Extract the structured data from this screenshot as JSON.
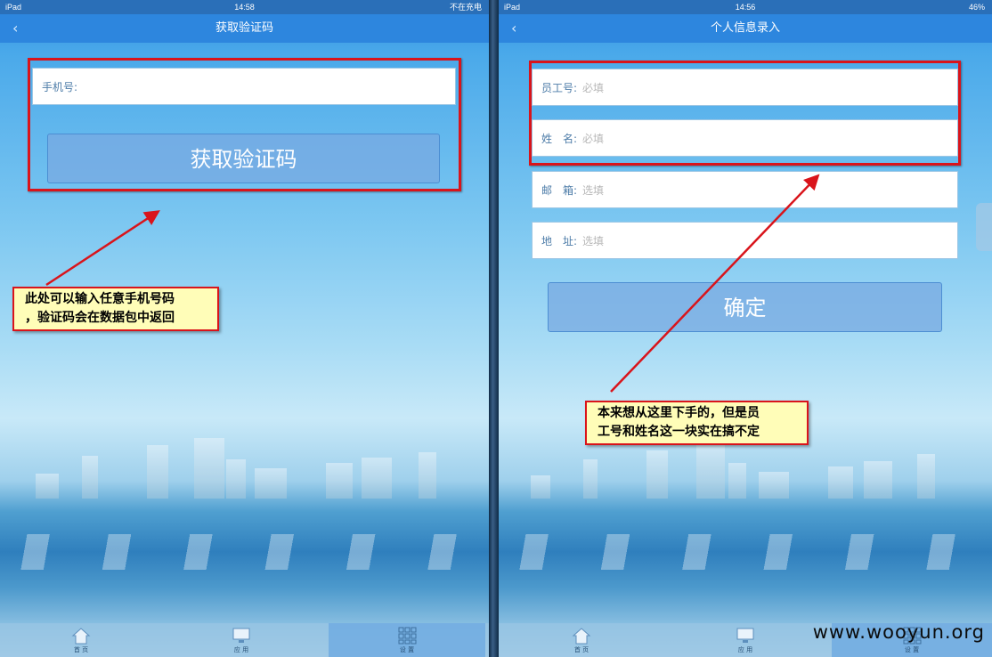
{
  "left": {
    "status": {
      "device": "iPad",
      "time": "14:58",
      "charging": "不在充电"
    },
    "nav": {
      "back": "‹",
      "title": "获取验证码"
    },
    "phone_label": "手机号:",
    "get_code_button": "获取验证码",
    "callout_lines": [
      "此处可以输入任意手机号码",
      "，验证码会在数据包中返回"
    ],
    "tabs": [
      {
        "label": "首 页",
        "icon": "home-icon"
      },
      {
        "label": "应 用",
        "icon": "monitor-icon"
      },
      {
        "label": "设 置",
        "icon": "grid-icon"
      }
    ]
  },
  "right": {
    "status": {
      "device": "iPad",
      "time": "14:56",
      "battery": "46%"
    },
    "nav": {
      "back": "‹",
      "title": "个人信息录入"
    },
    "fields": [
      {
        "label": "员工号:",
        "placeholder": "必填"
      },
      {
        "label": "姓　名:",
        "placeholder": "必填"
      },
      {
        "label": "邮　箱:",
        "placeholder": "选填"
      },
      {
        "label": "地　址:",
        "placeholder": "选填"
      }
    ],
    "confirm_button": "确定",
    "callout_lines": [
      "本来想从这里下手的，但是员",
      "工号和姓名这一块实在搞不定"
    ],
    "tabs": [
      {
        "label": "首 页",
        "icon": "home-icon"
      },
      {
        "label": "应 用",
        "icon": "monitor-icon"
      },
      {
        "label": "设 置",
        "icon": "grid-icon"
      }
    ]
  },
  "watermark": "www.wooyun.org",
  "colors": {
    "annotation_red": "#d9141b",
    "callout_bg": "#fffdb8",
    "nav_blue": "#2d86de"
  }
}
